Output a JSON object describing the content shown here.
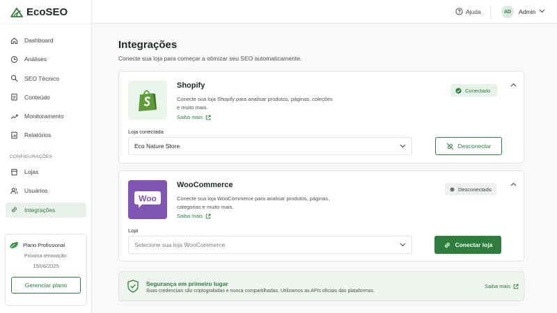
{
  "brand": {
    "name": "EcoSEO"
  },
  "colors": {
    "accent": "#2e7d3c",
    "accent_light": "#e8f2ea",
    "woo": "#7f54b3"
  },
  "header": {
    "help_label": "Ajuda",
    "avatar_initials": "AD",
    "user_name": "Admin"
  },
  "sidebar": {
    "items": [
      {
        "label": "Dashboard",
        "icon": "home-icon"
      },
      {
        "label": "Análises",
        "icon": "clock-chart-icon"
      },
      {
        "label": "SEO Técnico",
        "icon": "search-gear-icon"
      },
      {
        "label": "Conteúdo",
        "icon": "document-icon"
      },
      {
        "label": "Monitoramento",
        "icon": "trend-icon"
      },
      {
        "label": "Relatórios",
        "icon": "report-icon"
      }
    ],
    "section_label": "CONFIGURAÇÕES",
    "config_items": [
      {
        "label": "Lojas",
        "icon": "store-icon"
      },
      {
        "label": "Usuários",
        "icon": "users-icon"
      },
      {
        "label": "Integrações",
        "icon": "link-icon",
        "active": true
      }
    ],
    "plan": {
      "name": "Plano Profissional",
      "renewal_label": "Próxima renovação:",
      "renewal_date": "15/06/2025",
      "manage_label": "Gerenciar plano"
    }
  },
  "main": {
    "title": "Integrações",
    "subtitle": "Conecte sua loja para começar a otimizar seu SEO automaticamente.",
    "integrations": [
      {
        "name": "Shopify",
        "description": "Conecte sua loja Shopify para analisar produtos, páginas, coleções e muito mais.",
        "learn_more": "Saiba mais",
        "status": "Conectado",
        "field_label": "Loja conectada",
        "selected_store": "Eco Nature Store",
        "action_label": "Desconectar"
      },
      {
        "name": "WooCommerce",
        "logo_text": "Woo",
        "description": "Conecte sua loja WooCommerce para analisar produtos, páginas, categorias e muito mais.",
        "learn_more": "Saiba mais",
        "status": "Desconectado",
        "field_label": "Loja",
        "placeholder": "Selecione sua loja WooCommerce",
        "action_label": "Conectar loja"
      }
    ],
    "security": {
      "title": "Segurança em primeiro lugar",
      "description": "Suas credenciais são criptografadas e nunca compartilhadas. Utilizamos as APIs oficiais das plataformas.",
      "learn_more": "Saiba mais"
    }
  }
}
